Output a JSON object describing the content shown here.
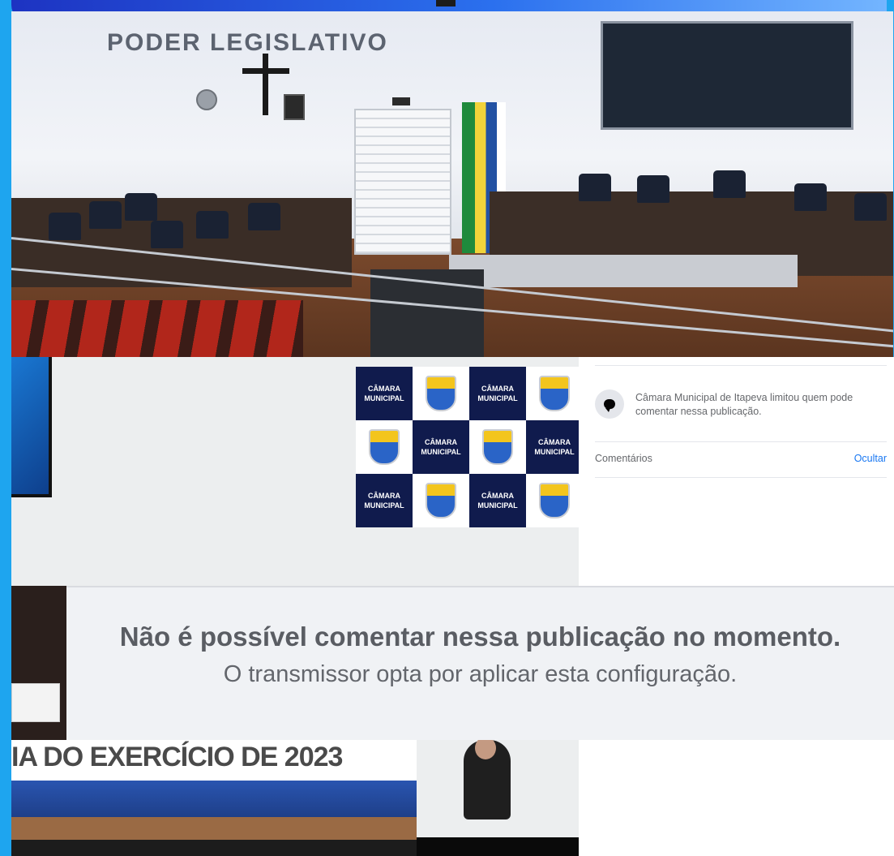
{
  "hall_photo": {
    "wall_text": "PODER LEGISLATIVO"
  },
  "backdrop": {
    "tile_text": "CÂMARA MUNICIPAL"
  },
  "post_panel": {
    "notice_text": "Câmara Municipal de Itapeva limitou quem pode comentar nessa publicação.",
    "comments_label": "Comentários",
    "hide_link": "Ocultar"
  },
  "banner": {
    "title": "Não é possível comentar nessa publicação no momento.",
    "subtitle": "O transmissor opta por aplicar esta configuração."
  },
  "slide": {
    "title": "IA DO EXERCÍCIO DE 2023"
  },
  "colors": {
    "frame_border": "#1ea5ef",
    "link": "#1877f2",
    "banner_bg": "#f0f2f5"
  }
}
